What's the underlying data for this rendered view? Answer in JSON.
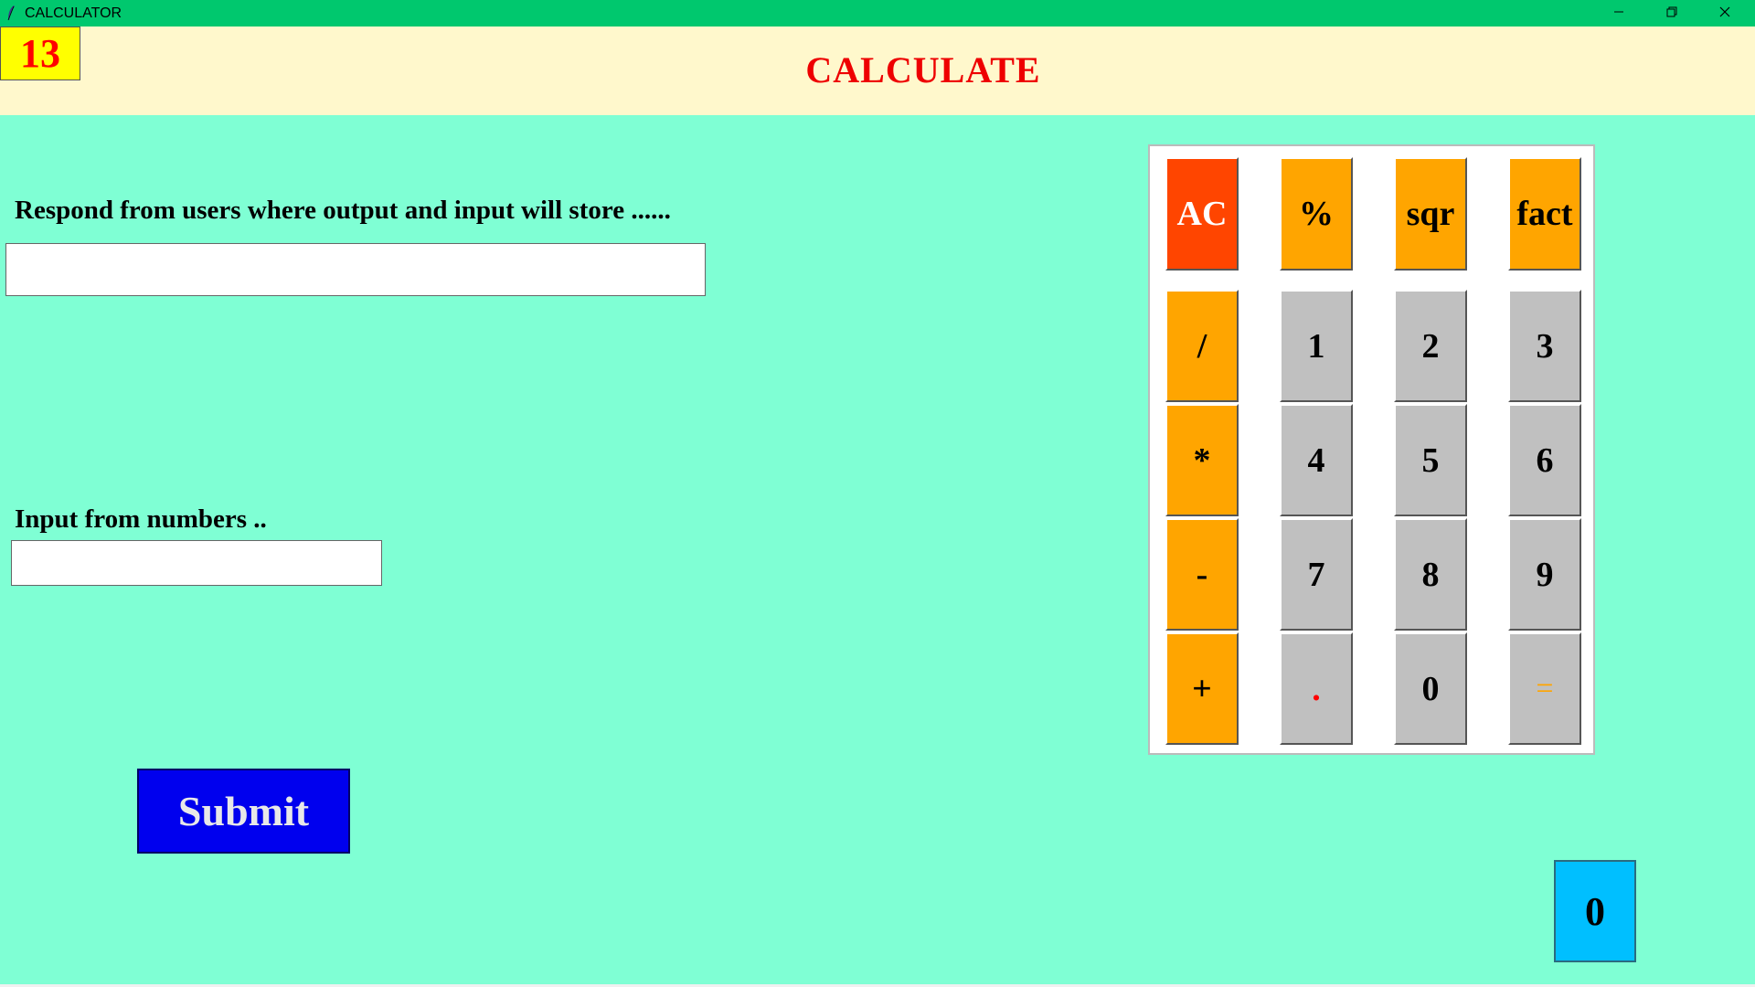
{
  "window": {
    "title": "CALCULATOR",
    "controls": {
      "minimize_icon": "minimize-icon",
      "maximize_icon": "restore-icon",
      "close_icon": "close-icon"
    }
  },
  "header": {
    "counter": "13",
    "title": "CALCULATE"
  },
  "form": {
    "respond_label": "Respond from users where output and input will store  ......",
    "respond_value": "",
    "numbers_label": "Input from numbers  ..",
    "numbers_value": "",
    "submit_label": "Submit"
  },
  "keypad": {
    "row0": [
      "AC",
      "%",
      "sqr",
      "fact"
    ],
    "row1": [
      "/",
      "1",
      "2",
      "3"
    ],
    "row2": [
      "*",
      "4",
      "5",
      "6"
    ],
    "row3": [
      "-",
      "7",
      "8",
      "9"
    ],
    "row4": [
      "+",
      ".",
      "0",
      "="
    ]
  },
  "result": "0",
  "colors": {
    "background": "#7fffd4",
    "titlebar": "#00c86e",
    "header_band": "#fff8cc",
    "counter_bg": "#ffff00",
    "title_text": "#ee0000",
    "operator_key": "#ffa500",
    "clear_key": "#ff4500",
    "digit_key": "#c0c0c0",
    "submit_bg": "#0000ee",
    "result_bg": "#00bfff"
  }
}
